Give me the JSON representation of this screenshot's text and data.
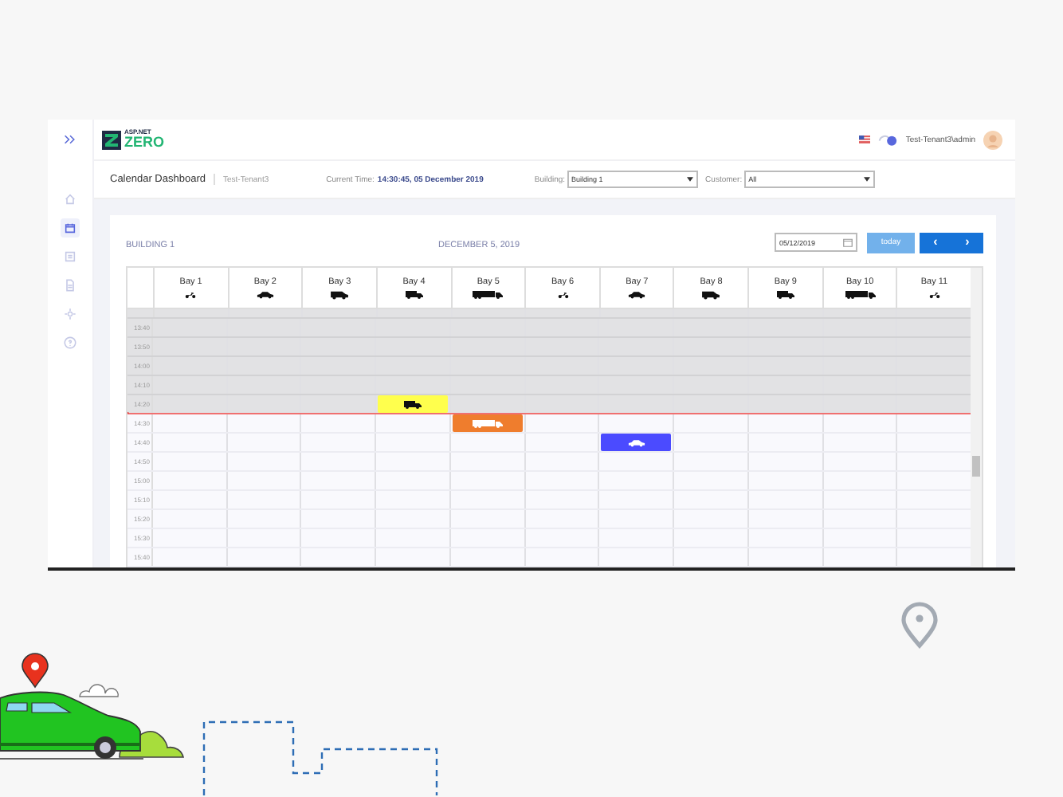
{
  "sidebar": {
    "items": [
      {
        "selected": false
      },
      {
        "selected": true
      },
      {
        "selected": false
      },
      {
        "selected": false
      },
      {
        "selected": false
      },
      {
        "selected": false
      }
    ]
  },
  "topbar": {
    "logo_small": "ASP.NET",
    "logo_large": "ZERO",
    "user": "Test-Tenant3\\admin"
  },
  "subheader": {
    "title": "Calendar Dashboard",
    "tenant": "Test-Tenant3",
    "time_label": "Current Time:",
    "time": "14:30:45, 05 December 2019",
    "building_label": "Building:",
    "building_value": "Building 1",
    "customer_label": "Customer:",
    "customer_value": "All"
  },
  "calendar": {
    "building": "BUILDING 1",
    "date_title": "DECEMBER 5, 2019",
    "date_field": "05/12/2019",
    "today_button": {
      "label": "today",
      "disabled": true
    },
    "prev": "‹",
    "next": "›",
    "bays": [
      {
        "name": "Bay 1",
        "kind": "motorcycle"
      },
      {
        "name": "Bay 2",
        "kind": "car"
      },
      {
        "name": "Bay 3",
        "kind": "van"
      },
      {
        "name": "Bay 4",
        "kind": "truck"
      },
      {
        "name": "Bay 5",
        "kind": "semi"
      },
      {
        "name": "Bay 6",
        "kind": "motorcycle"
      },
      {
        "name": "Bay 7",
        "kind": "car"
      },
      {
        "name": "Bay 8",
        "kind": "van"
      },
      {
        "name": "Bay 9",
        "kind": "truck"
      },
      {
        "name": "Bay 10",
        "kind": "semi"
      },
      {
        "name": "Bay 11",
        "kind": "motorcycle"
      }
    ],
    "slots": [
      {
        "time": "13:40",
        "past": true,
        "now": false,
        "cells": [
          {
            "kind": "free"
          },
          {
            "kind": "free"
          },
          {
            "kind": "free"
          },
          {
            "kind": "free"
          },
          {
            "kind": "free"
          },
          {
            "kind": "free"
          },
          {
            "kind": "free"
          },
          {
            "kind": "free"
          },
          {
            "kind": "free"
          },
          {
            "kind": "free"
          },
          {
            "kind": "free"
          }
        ]
      },
      {
        "time": "13:50",
        "past": true,
        "now": false,
        "cells": [
          {
            "kind": "free"
          },
          {
            "kind": "free"
          },
          {
            "kind": "free"
          },
          {
            "kind": "free"
          },
          {
            "kind": "free"
          },
          {
            "kind": "free"
          },
          {
            "kind": "free"
          },
          {
            "kind": "free"
          },
          {
            "kind": "free"
          },
          {
            "kind": "free"
          },
          {
            "kind": "free"
          }
        ]
      },
      {
        "time": "14:00",
        "past": true,
        "now": false,
        "cells": [
          {
            "kind": "free"
          },
          {
            "kind": "free"
          },
          {
            "kind": "free"
          },
          {
            "kind": "free"
          },
          {
            "kind": "free"
          },
          {
            "kind": "free"
          },
          {
            "kind": "free"
          },
          {
            "kind": "free"
          },
          {
            "kind": "free"
          },
          {
            "kind": "free"
          },
          {
            "kind": "free"
          }
        ]
      },
      {
        "time": "14:10",
        "past": true,
        "now": false,
        "cells": [
          {
            "kind": "free"
          },
          {
            "kind": "free"
          },
          {
            "kind": "free"
          },
          {
            "kind": "free"
          },
          {
            "kind": "free"
          },
          {
            "kind": "free"
          },
          {
            "kind": "free"
          },
          {
            "kind": "free"
          },
          {
            "kind": "free"
          },
          {
            "kind": "free"
          },
          {
            "kind": "free"
          }
        ]
      },
      {
        "time": "14:20",
        "past": true,
        "now": false,
        "cells": [
          {
            "kind": "free"
          },
          {
            "kind": "free"
          },
          {
            "kind": "free"
          },
          {
            "kind": "truck",
            "color": "#ffff4d"
          },
          {
            "kind": "free"
          },
          {
            "kind": "free"
          },
          {
            "kind": "free"
          },
          {
            "kind": "free"
          },
          {
            "kind": "free"
          },
          {
            "kind": "free"
          },
          {
            "kind": "free"
          }
        ]
      },
      {
        "time": "14:30",
        "past": false,
        "now": true,
        "cells": [
          {
            "kind": "free"
          },
          {
            "kind": "free"
          },
          {
            "kind": "free"
          },
          {
            "kind": "free"
          },
          {
            "kind": "semi",
            "color": "#ef7d2d"
          },
          {
            "kind": "free"
          },
          {
            "kind": "free"
          },
          {
            "kind": "free"
          },
          {
            "kind": "free"
          },
          {
            "kind": "free"
          },
          {
            "kind": "free"
          }
        ]
      },
      {
        "time": "14:40",
        "past": false,
        "now": false,
        "cells": [
          {
            "kind": "free"
          },
          {
            "kind": "free"
          },
          {
            "kind": "free"
          },
          {
            "kind": "free"
          },
          {
            "kind": "free"
          },
          {
            "kind": "free"
          },
          {
            "kind": "car",
            "color": "#4b4bff"
          },
          {
            "kind": "free"
          },
          {
            "kind": "free"
          },
          {
            "kind": "free"
          },
          {
            "kind": "free"
          }
        ]
      },
      {
        "time": "14:50",
        "past": false,
        "now": false,
        "cells": [
          {
            "kind": "free"
          },
          {
            "kind": "free"
          },
          {
            "kind": "free"
          },
          {
            "kind": "free"
          },
          {
            "kind": "free"
          },
          {
            "kind": "free"
          },
          {
            "kind": "free"
          },
          {
            "kind": "free"
          },
          {
            "kind": "free"
          },
          {
            "kind": "free"
          },
          {
            "kind": "free"
          }
        ]
      },
      {
        "time": "15:00",
        "past": false,
        "now": false,
        "cells": [
          {
            "kind": "free"
          },
          {
            "kind": "free"
          },
          {
            "kind": "free"
          },
          {
            "kind": "free"
          },
          {
            "kind": "free"
          },
          {
            "kind": "free"
          },
          {
            "kind": "free"
          },
          {
            "kind": "free"
          },
          {
            "kind": "free"
          },
          {
            "kind": "free"
          },
          {
            "kind": "free"
          }
        ]
      },
      {
        "time": "15:10",
        "past": false,
        "now": false,
        "cells": [
          {
            "kind": "free"
          },
          {
            "kind": "free"
          },
          {
            "kind": "free"
          },
          {
            "kind": "free"
          },
          {
            "kind": "free"
          },
          {
            "kind": "free"
          },
          {
            "kind": "free"
          },
          {
            "kind": "free"
          },
          {
            "kind": "free"
          },
          {
            "kind": "free"
          },
          {
            "kind": "free"
          }
        ]
      },
      {
        "time": "15:20",
        "past": false,
        "now": false,
        "cells": [
          {
            "kind": "free"
          },
          {
            "kind": "free"
          },
          {
            "kind": "free"
          },
          {
            "kind": "free"
          },
          {
            "kind": "free"
          },
          {
            "kind": "free"
          },
          {
            "kind": "free"
          },
          {
            "kind": "free"
          },
          {
            "kind": "free"
          },
          {
            "kind": "free"
          },
          {
            "kind": "free"
          }
        ]
      },
      {
        "time": "15:30",
        "past": false,
        "now": false,
        "cells": [
          {
            "kind": "free"
          },
          {
            "kind": "free"
          },
          {
            "kind": "free"
          },
          {
            "kind": "free"
          },
          {
            "kind": "free"
          },
          {
            "kind": "free"
          },
          {
            "kind": "free"
          },
          {
            "kind": "free"
          },
          {
            "kind": "free"
          },
          {
            "kind": "free"
          },
          {
            "kind": "free"
          }
        ]
      },
      {
        "time": "15:40",
        "past": false,
        "now": false,
        "cells": [
          {
            "kind": "free"
          },
          {
            "kind": "free"
          },
          {
            "kind": "free"
          },
          {
            "kind": "free"
          },
          {
            "kind": "free"
          },
          {
            "kind": "free"
          },
          {
            "kind": "free"
          },
          {
            "kind": "free"
          },
          {
            "kind": "free"
          },
          {
            "kind": "free"
          },
          {
            "kind": "free"
          }
        ]
      }
    ]
  }
}
